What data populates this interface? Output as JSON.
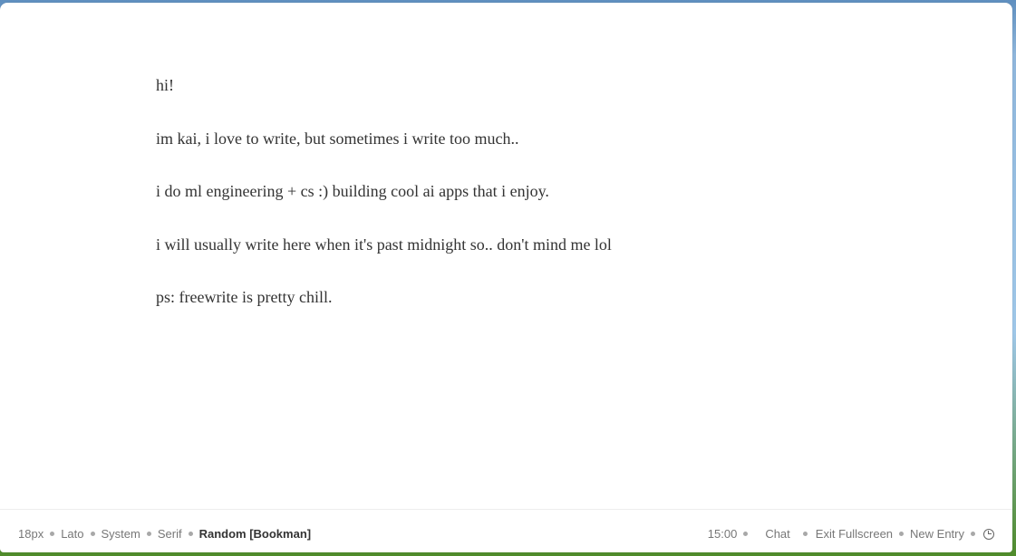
{
  "editor": {
    "paragraphs": [
      "hi!",
      "im kai, i love to write, but sometimes i write too much..",
      "i do ml engineering + cs :) building cool ai apps that i enjoy.",
      "i will usually write here when it's past midnight so.. don't mind me lol",
      "ps: freewrite is pretty chill."
    ]
  },
  "bottom_bar": {
    "font_size": "18px",
    "font_lato": "Lato",
    "font_system": "System",
    "font_serif": "Serif",
    "font_random": "Random [Bookman]",
    "timer": "15:00",
    "chat": "Chat",
    "fullscreen": "Exit Fullscreen",
    "new_entry": "New Entry",
    "history_icon": "clock-icon"
  }
}
